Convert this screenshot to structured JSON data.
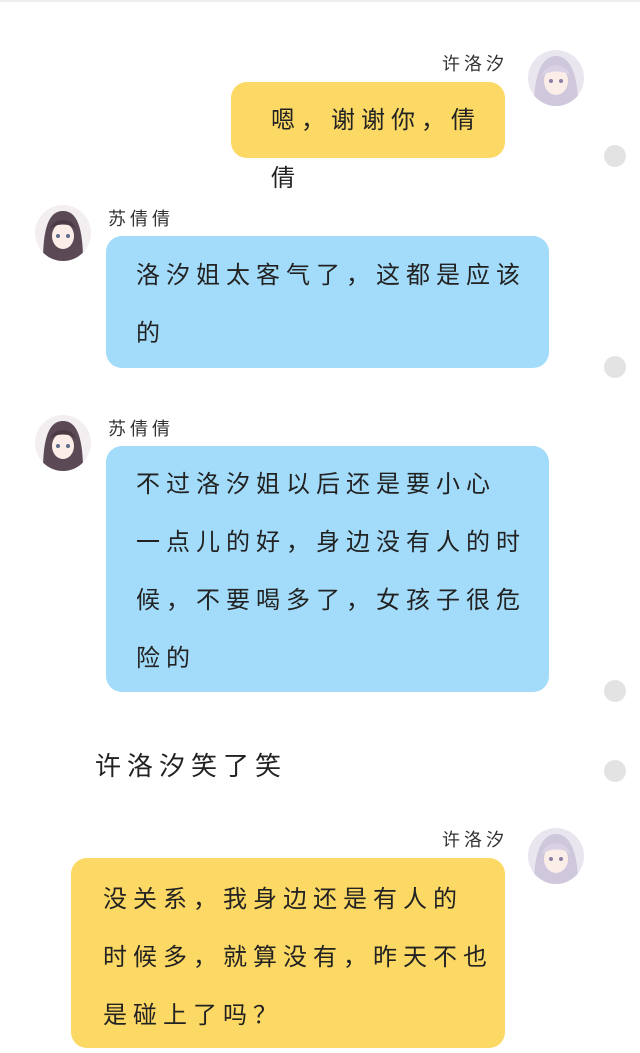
{
  "messages": [
    {
      "sender": "许洛汐",
      "side": "right",
      "text": "嗯，谢谢你，倩倩",
      "color": "#fcd864"
    },
    {
      "sender": "苏倩倩",
      "side": "left",
      "text": "洛汐姐太客气了，这都是应该\n的",
      "color": "#a3dcfa"
    },
    {
      "sender": "苏倩倩",
      "side": "left",
      "text": "不过洛汐姐以后还是要小心\n一点儿的好，身边没有人的时\n候，不要喝多了，女孩子很危\n险的",
      "color": "#a3dcfa"
    },
    {
      "sender": "许洛汐",
      "side": "right",
      "text": "没关系，我身边还是有人的\n时候多，就算没有，昨天不也\n是碰上了吗？",
      "color": "#fcd864"
    }
  ],
  "narration": "许洛汐笑了笑"
}
